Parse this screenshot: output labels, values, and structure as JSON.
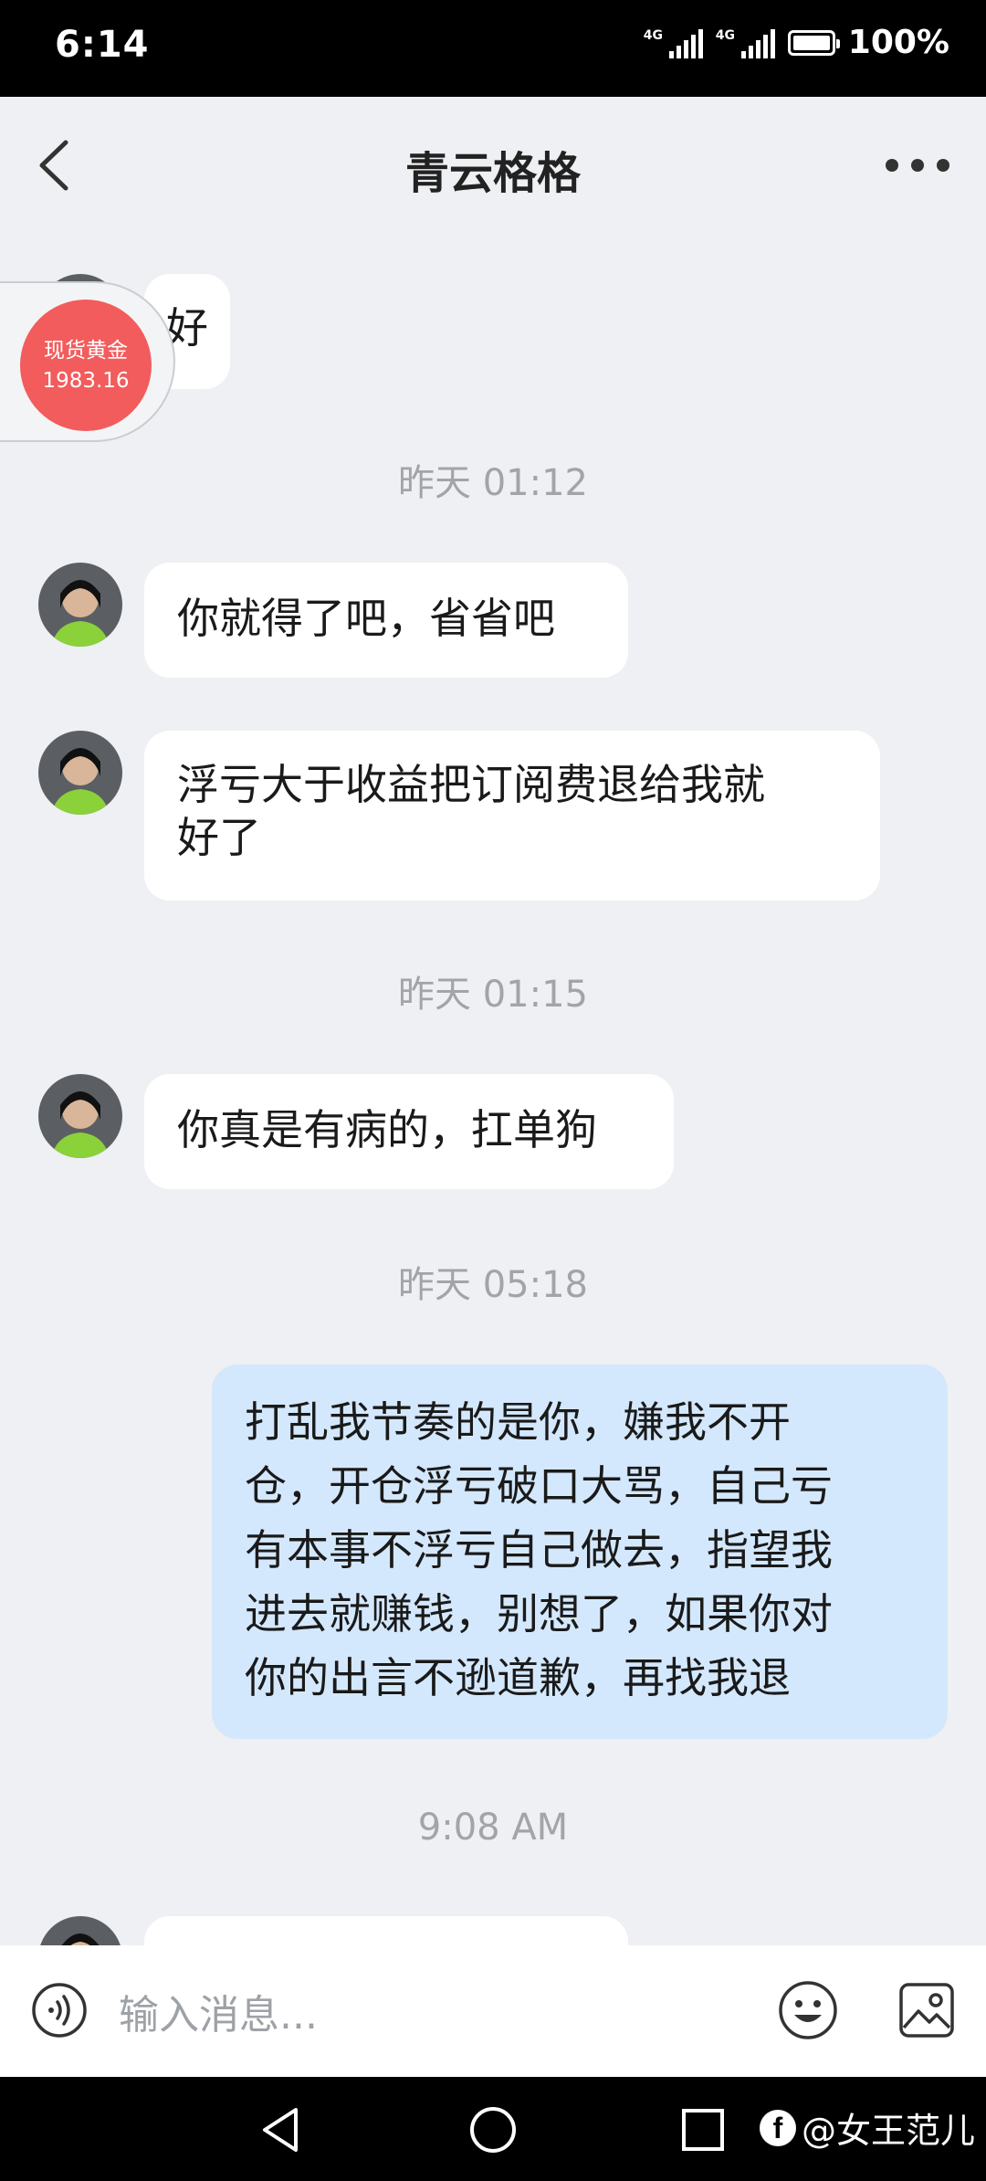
{
  "status_bar": {
    "time": "6:14",
    "network_1": "4G",
    "network_2": "4G",
    "battery": "100%"
  },
  "header": {
    "title": "青云格格"
  },
  "gold_widget": {
    "label": "现货黄金",
    "value": "1983.16"
  },
  "messages": [
    {
      "side": "in",
      "text": "好"
    },
    {
      "timestamp": "昨天 01:12"
    },
    {
      "side": "in",
      "text": "你就得了吧，省省吧"
    },
    {
      "side": "in",
      "line1": "浮亏大于收益把订阅费退给我就",
      "line2": "好了"
    },
    {
      "timestamp": "昨天 01:15"
    },
    {
      "side": "in",
      "text": "你真是有病的，扛单狗"
    },
    {
      "timestamp": "昨天 05:18"
    },
    {
      "side": "out",
      "line1": "打乱我节奏的是你，嫌我不开",
      "line2": "仓，开仓浮亏破口大骂，自己亏",
      "line3": "有本事不浮亏自己做去，指望我",
      "line4": "进去就赚钱，别想了，如果你对",
      "line5": "你的出言不逊道歉，再找我退"
    },
    {
      "timestamp": "9:08 AM"
    }
  ],
  "input_bar": {
    "placeholder": "输入消息..."
  },
  "watermark": "@女王范儿",
  "icons": {
    "back": "chevron-left-icon",
    "more": "more-dots-icon",
    "voice": "voice-icon",
    "emoji": "emoji-icon",
    "image": "image-icon"
  }
}
